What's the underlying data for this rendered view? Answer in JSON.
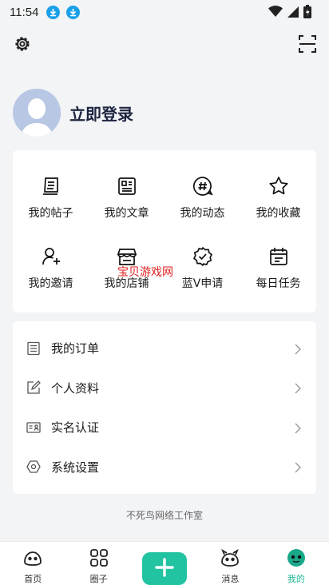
{
  "status_bar": {
    "time": "11:54"
  },
  "profile": {
    "login_label": "立即登录"
  },
  "grid": {
    "items": [
      {
        "label": "我的帖子",
        "icon": "post-icon"
      },
      {
        "label": "我的文章",
        "icon": "article-icon"
      },
      {
        "label": "我的动态",
        "icon": "hashtag-icon"
      },
      {
        "label": "我的收藏",
        "icon": "star-icon"
      },
      {
        "label": "我的邀请",
        "icon": "invite-user-icon"
      },
      {
        "label": "我的店铺",
        "icon": "store-icon"
      },
      {
        "label": "蓝V申请",
        "icon": "verified-badge-icon"
      },
      {
        "label": "每日任务",
        "icon": "calendar-icon"
      }
    ]
  },
  "menu": {
    "items": [
      {
        "label": "我的订单",
        "icon": "order-icon"
      },
      {
        "label": "个人资料",
        "icon": "edit-profile-icon"
      },
      {
        "label": "实名认证",
        "icon": "id-card-icon"
      },
      {
        "label": "系统设置",
        "icon": "settings-hex-icon"
      }
    ]
  },
  "footer": {
    "text": "不死鸟网络工作室"
  },
  "watermark": {
    "text": "宝贝游戏网"
  },
  "bottom_nav": {
    "items": [
      {
        "label": "首页",
        "active": false
      },
      {
        "label": "圈子",
        "active": false
      },
      {
        "label": "",
        "active": false
      },
      {
        "label": "消息",
        "active": false
      },
      {
        "label": "我的",
        "active": true
      }
    ]
  },
  "colors": {
    "accent": "#22c3a0",
    "active_text": "#1fb596",
    "download_icon": "#1aa0e8",
    "watermark": "#e02020"
  }
}
